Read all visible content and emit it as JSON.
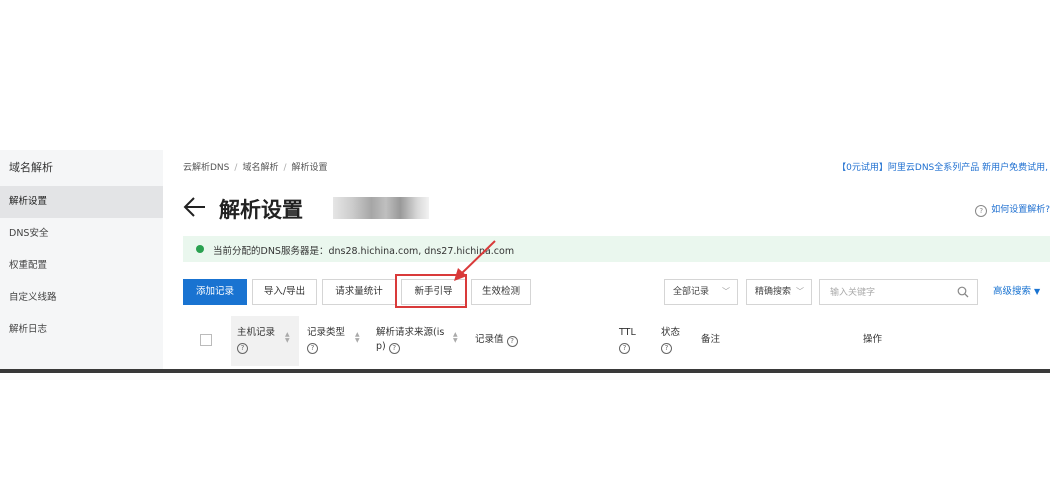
{
  "sidebar": {
    "title": "域名解析",
    "items": [
      {
        "label": "解析设置",
        "active": true
      },
      {
        "label": "DNS安全",
        "active": false
      },
      {
        "label": "权重配置",
        "active": false
      },
      {
        "label": "自定义线路",
        "active": false
      },
      {
        "label": "解析日志",
        "active": false
      }
    ]
  },
  "breadcrumb": [
    "云解析DNS",
    "域名解析",
    "解析设置"
  ],
  "promo_text": "【0元试用】阿里云DNS全系列产品 新用户免费试用,",
  "page": {
    "title": "解析设置",
    "help_link": "如何设置解析?"
  },
  "notice": "当前分配的DNS服务器是：dns28.hichina.com, dns27.hichina.com",
  "toolbar": {
    "add_record": "添加记录",
    "import_export": "导入/导出",
    "request_stats": "请求量统计",
    "beginner_guide": "新手引导",
    "effect_check": "生效检测",
    "record_filter": "全部记录",
    "search_mode": "精确搜索",
    "search_placeholder": "输入关键字",
    "advanced_search": "高级搜索"
  },
  "table": {
    "columns": {
      "host": "主机记录",
      "type": "记录类型",
      "source_line1": "解析请求来源(is",
      "source_line2": "p)",
      "value": "记录值",
      "ttl": "TTL",
      "status": "状态",
      "remark": "备注",
      "actions": "操作"
    }
  },
  "colors": {
    "accent": "#1973d1",
    "highlight": "#d93a3a",
    "notice_bg": "#eaf7ee",
    "status_dot": "#2aa150"
  }
}
